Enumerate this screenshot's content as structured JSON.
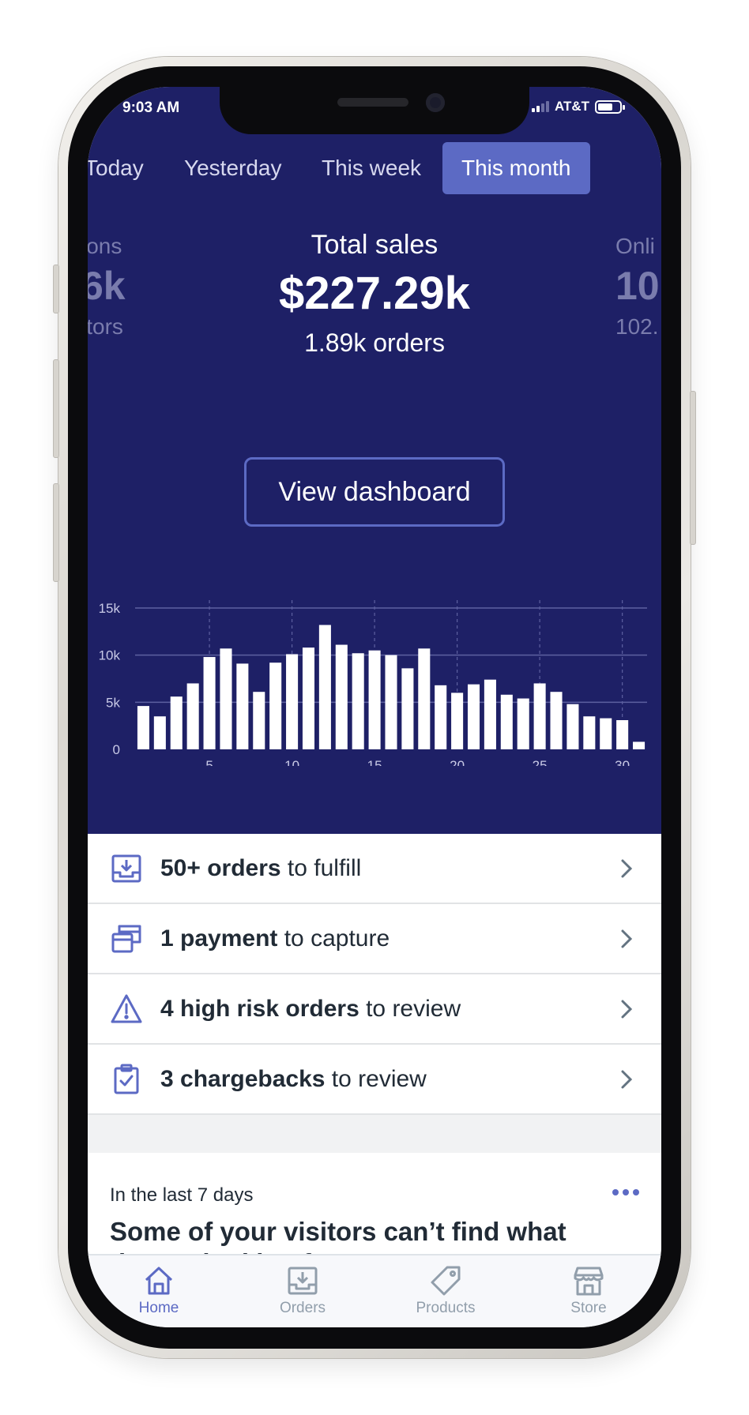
{
  "status_bar": {
    "time": "9:03 AM",
    "carrier": "AT&T"
  },
  "period_tabs": [
    {
      "label": "Today",
      "active": false
    },
    {
      "label": "Yesterday",
      "active": false
    },
    {
      "label": "This week",
      "active": false
    },
    {
      "label": "This month",
      "active": true
    }
  ],
  "stats": {
    "left": {
      "label": "ions",
      "value": "6k",
      "sub": "itors"
    },
    "center": {
      "label": "Total sales",
      "value": "$227.29k",
      "sub": "1.89k orders"
    },
    "right": {
      "label": "Onli",
      "value": "10",
      "sub": "102."
    }
  },
  "view_dashboard_label": "View dashboard",
  "chart_data": {
    "type": "bar",
    "categories": [
      "1",
      "2",
      "3",
      "4",
      "5",
      "6",
      "7",
      "8",
      "9",
      "10",
      "11",
      "12",
      "13",
      "14",
      "15",
      "16",
      "17",
      "18",
      "19",
      "20",
      "21",
      "22",
      "23",
      "24",
      "25",
      "26",
      "27",
      "28",
      "29",
      "30",
      "31"
    ],
    "values": [
      4.6,
      3.5,
      5.6,
      7.0,
      9.8,
      10.7,
      9.1,
      6.1,
      9.2,
      10.1,
      10.8,
      13.2,
      11.1,
      10.2,
      10.5,
      10.0,
      8.6,
      10.7,
      6.8,
      6.0,
      6.9,
      7.4,
      5.8,
      5.4,
      7.0,
      6.1,
      4.8,
      3.5,
      3.3,
      3.1,
      0.8
    ],
    "ylim": [
      0,
      15
    ],
    "yticks": [
      "0",
      "5k",
      "10k",
      "15k"
    ],
    "yticks_values": [
      0,
      5,
      10,
      15
    ],
    "xticks": [
      "5",
      "10",
      "15",
      "20",
      "25",
      "30"
    ],
    "xticks_values": [
      5,
      10,
      15,
      20,
      25,
      30
    ],
    "colors": {
      "bar": "#ffffff",
      "grid": "#5d60a0",
      "axis_text": "#c8c9e6",
      "background": "#1e2066"
    }
  },
  "tasks": [
    {
      "icon": "inbox-download-icon",
      "strong": "50+ orders",
      "rest": " to fulfill"
    },
    {
      "icon": "payment-card-icon",
      "strong": "1 payment",
      "rest": " to capture"
    },
    {
      "icon": "warning-triangle-icon",
      "strong": "4 high risk orders",
      "rest": " to review"
    },
    {
      "icon": "clipboard-check-icon",
      "strong": "3 chargebacks",
      "rest": " to review"
    }
  ],
  "insight": {
    "subtitle": "In the last 7 days",
    "title": "Some of your visitors can’t find what they’re looking for"
  },
  "bottom_nav": [
    {
      "label": "Home",
      "icon": "home-icon",
      "active": true
    },
    {
      "label": "Orders",
      "icon": "orders-icon",
      "active": false
    },
    {
      "label": "Products",
      "icon": "tag-icon",
      "active": false
    },
    {
      "label": "Store",
      "icon": "store-icon",
      "active": false
    }
  ],
  "colors": {
    "brand_navy": "#1e2066",
    "accent": "#5c6ac4",
    "text": "#212b36",
    "muted": "#919eab"
  }
}
